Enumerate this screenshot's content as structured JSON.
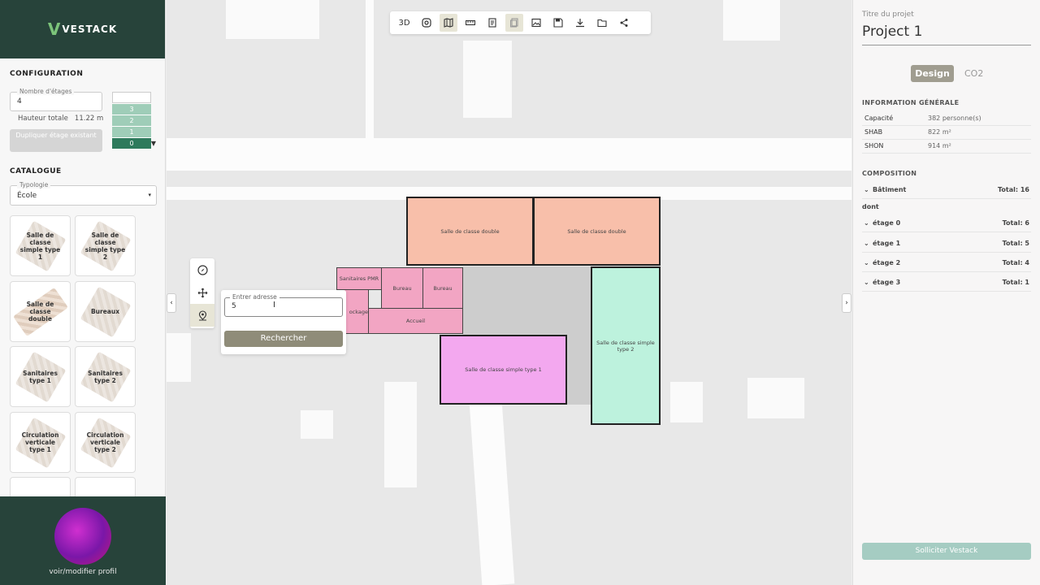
{
  "brand": {
    "name": "VESTACK",
    "mark": "V"
  },
  "configuration": {
    "section_title": "CONFIGURATION",
    "floors_label": "Nombre d'étages",
    "floors_value": "4",
    "height_label": "Hauteur totale",
    "height_value": "11.22 m",
    "duplicate_button": "Dupliquer étage existant",
    "floors": [
      "3",
      "2",
      "1",
      "0"
    ],
    "active_floor": "0"
  },
  "catalogue": {
    "section_title": "CATALOGUE",
    "typology_label": "Typologie",
    "typology_value": "École",
    "items": [
      {
        "label": "Salle de classe simple type 1"
      },
      {
        "label": "Salle de classe simple type 2"
      },
      {
        "label": "Salle de classe double"
      },
      {
        "label": "Bureaux"
      },
      {
        "label": "Sanitaires type 1"
      },
      {
        "label": "Sanitaires type 2"
      },
      {
        "label": "Circulation verticale type 1"
      },
      {
        "label": "Circulation verticale type 2"
      }
    ]
  },
  "profile": {
    "link": "voir/modifier profil"
  },
  "toolbar": {
    "view_3d": "3D",
    "icons": [
      "3d-view-icon",
      "focus-icon",
      "map-icon",
      "ruler-icon",
      "notes-icon",
      "copy-icon",
      "image-icon",
      "save-icon",
      "download-icon",
      "folder-icon",
      "share-icon"
    ]
  },
  "side_tools": [
    "compass-icon",
    "move-icon",
    "location-pin-icon"
  ],
  "search": {
    "label": "Entrer adresse",
    "value": "5",
    "button": "Rechercher"
  },
  "plan": {
    "rooms": [
      {
        "label": "Salle de classe double",
        "color": "#f8bfaa"
      },
      {
        "label": "Salle de classe double",
        "color": "#f8bfaa"
      },
      {
        "label": "Sanitaires PMR",
        "color": "#f2a5c3"
      },
      {
        "label": "Bureau",
        "color": "#f2a5c3"
      },
      {
        "label": "Bureau",
        "color": "#f2a5c3"
      },
      {
        "label": "ockage",
        "color": "#f2a5c3"
      },
      {
        "label": "Accueil",
        "color": "#f2a5c3"
      },
      {
        "label": "Salle de classe simple type 1",
        "color": "#f3a8ef"
      },
      {
        "label": "Salle de classe simple type 2",
        "color": "#bdf2dd"
      }
    ],
    "circulation_color": "#cdcdcd"
  },
  "right_panel": {
    "title_label": "Titre du projet",
    "project_title": "Project 1",
    "tabs": {
      "design": "Design",
      "co2": "CO2"
    },
    "info_title": "INFORMATION GÉNÉRALE",
    "info": [
      {
        "key": "Capacité",
        "value": "382 personne(s)"
      },
      {
        "key": "SHAB",
        "value": "822 m²"
      },
      {
        "key": "SHON",
        "value": "914 m²"
      }
    ],
    "composition_title": "COMPOSITION",
    "building": {
      "label": "Bâtiment",
      "total": "Total: 16"
    },
    "dont": "dont",
    "levels": [
      {
        "label": "étage 0",
        "total": "Total: 6"
      },
      {
        "label": "étage 1",
        "total": "Total: 5"
      },
      {
        "label": "étage 2",
        "total": "Total: 4"
      },
      {
        "label": "étage 3",
        "total": "Total: 1"
      }
    ],
    "solicit_button": "Solliciter Vestack"
  }
}
